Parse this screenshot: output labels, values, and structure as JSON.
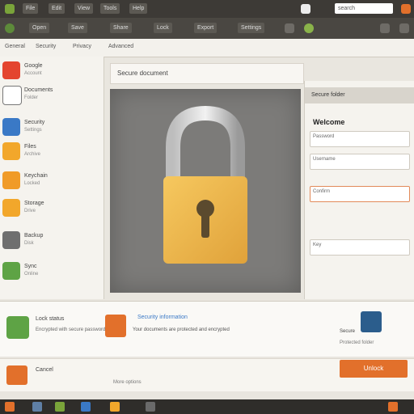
{
  "titlebar": {
    "menu": [
      "File",
      "Edit",
      "View",
      "Tools",
      "Help"
    ],
    "search_value": "search"
  },
  "toolbar": {
    "buttons": [
      "Open",
      "Save",
      "Share",
      "Lock",
      "Export",
      "Settings"
    ]
  },
  "chrome": {
    "tabs": [
      "General",
      "Security",
      "Privacy",
      "Advanced"
    ]
  },
  "sidebar": {
    "items": [
      {
        "label": "Google",
        "sub": "Account"
      },
      {
        "label": "Documents",
        "sub": "Folder"
      },
      {
        "label": "Security",
        "sub": "Settings"
      },
      {
        "label": "Files",
        "sub": "Archive"
      },
      {
        "label": "Keychain",
        "sub": "Locked"
      },
      {
        "label": "Storage",
        "sub": "Drive"
      },
      {
        "label": "Backup",
        "sub": "Disk"
      },
      {
        "label": "Sync",
        "sub": "Online"
      }
    ]
  },
  "center": {
    "title": "Secure document"
  },
  "rightpanel": {
    "heading": "Secure folder",
    "subheading": "Welcome",
    "fields": [
      {
        "label": "Password",
        "value": ""
      },
      {
        "label": "Username",
        "value": ""
      },
      {
        "label": "Confirm",
        "value": ""
      },
      {
        "label": "Key",
        "value": ""
      }
    ]
  },
  "bottom": {
    "item1_title": "Lock status",
    "item1_desc": "Encrypted with secure password",
    "item2_title": "Security information",
    "item2_desc": "Your documents are protected and encrypted",
    "item3_label": "Secure",
    "item3_desc": "Protected folder"
  },
  "actions": {
    "primary": "Unlock",
    "secondary": "Cancel",
    "link": "More options"
  },
  "colors": {
    "accent": "#e2702b",
    "lock_body": "#f0b54a"
  }
}
